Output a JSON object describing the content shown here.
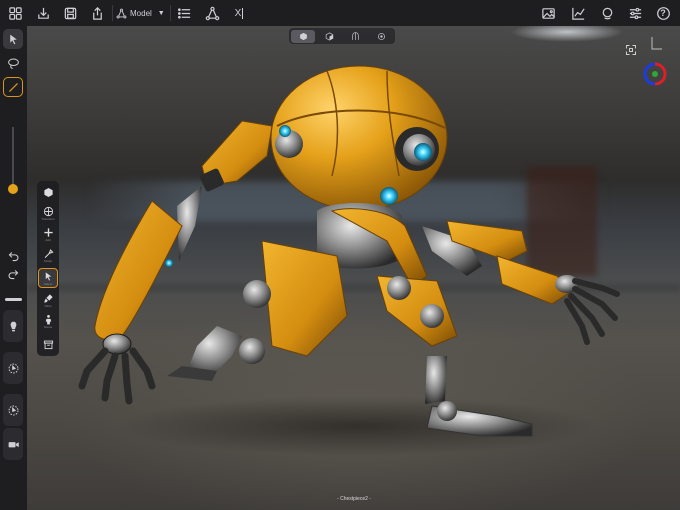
{
  "toolbar": {
    "mode_label": "Model",
    "xray_label": "X",
    "left_icons": [
      "grid-icon",
      "import-icon",
      "save-icon",
      "share-icon"
    ],
    "right_icons": [
      "image-icon",
      "chart-icon",
      "material-icon",
      "sliders-icon",
      "help-icon"
    ],
    "help_glyph": "?"
  },
  "view_modes": [
    "shaded",
    "solid",
    "wireframe",
    "point"
  ],
  "view_mode_active": "shaded",
  "left_rail": {
    "tools": [
      "select-tool",
      "lasso-tool",
      "brush-tool"
    ],
    "select_label": "Select",
    "brush_size_fraction": 0.05,
    "undo_icon": "undo-icon",
    "redo_icon": "redo-icon"
  },
  "tool_panel": {
    "items": [
      {
        "name": "cube",
        "label": ""
      },
      {
        "name": "transform",
        "label": "Transform"
      },
      {
        "name": "add",
        "label": "Add"
      },
      {
        "name": "sculpt",
        "label": "Sculpt"
      },
      {
        "name": "select",
        "label": "Select"
      },
      {
        "name": "paint",
        "label": "Paint"
      },
      {
        "name": "scene",
        "label": "Scene"
      },
      {
        "name": "archive",
        "label": ""
      }
    ],
    "selected": "select"
  },
  "scene": {
    "file_label": "- Chestpiece2 -"
  },
  "colors": {
    "accent": "#d9951c",
    "robot_orange": "#e09a16",
    "glow_cyan": "#3fd4ff",
    "background": "#1c1c1e"
  }
}
